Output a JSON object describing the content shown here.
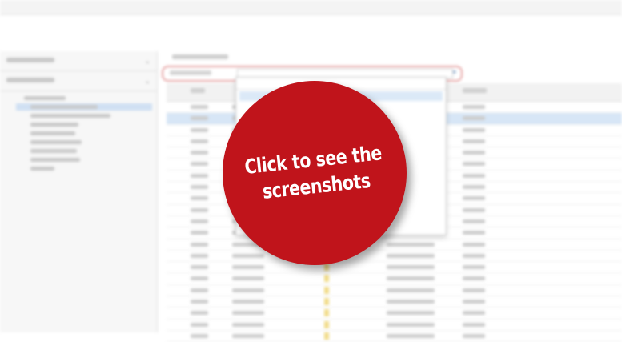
{
  "badge": {
    "lines": [
      "Click to see the",
      "screenshots"
    ],
    "color": "#c0141b"
  }
}
